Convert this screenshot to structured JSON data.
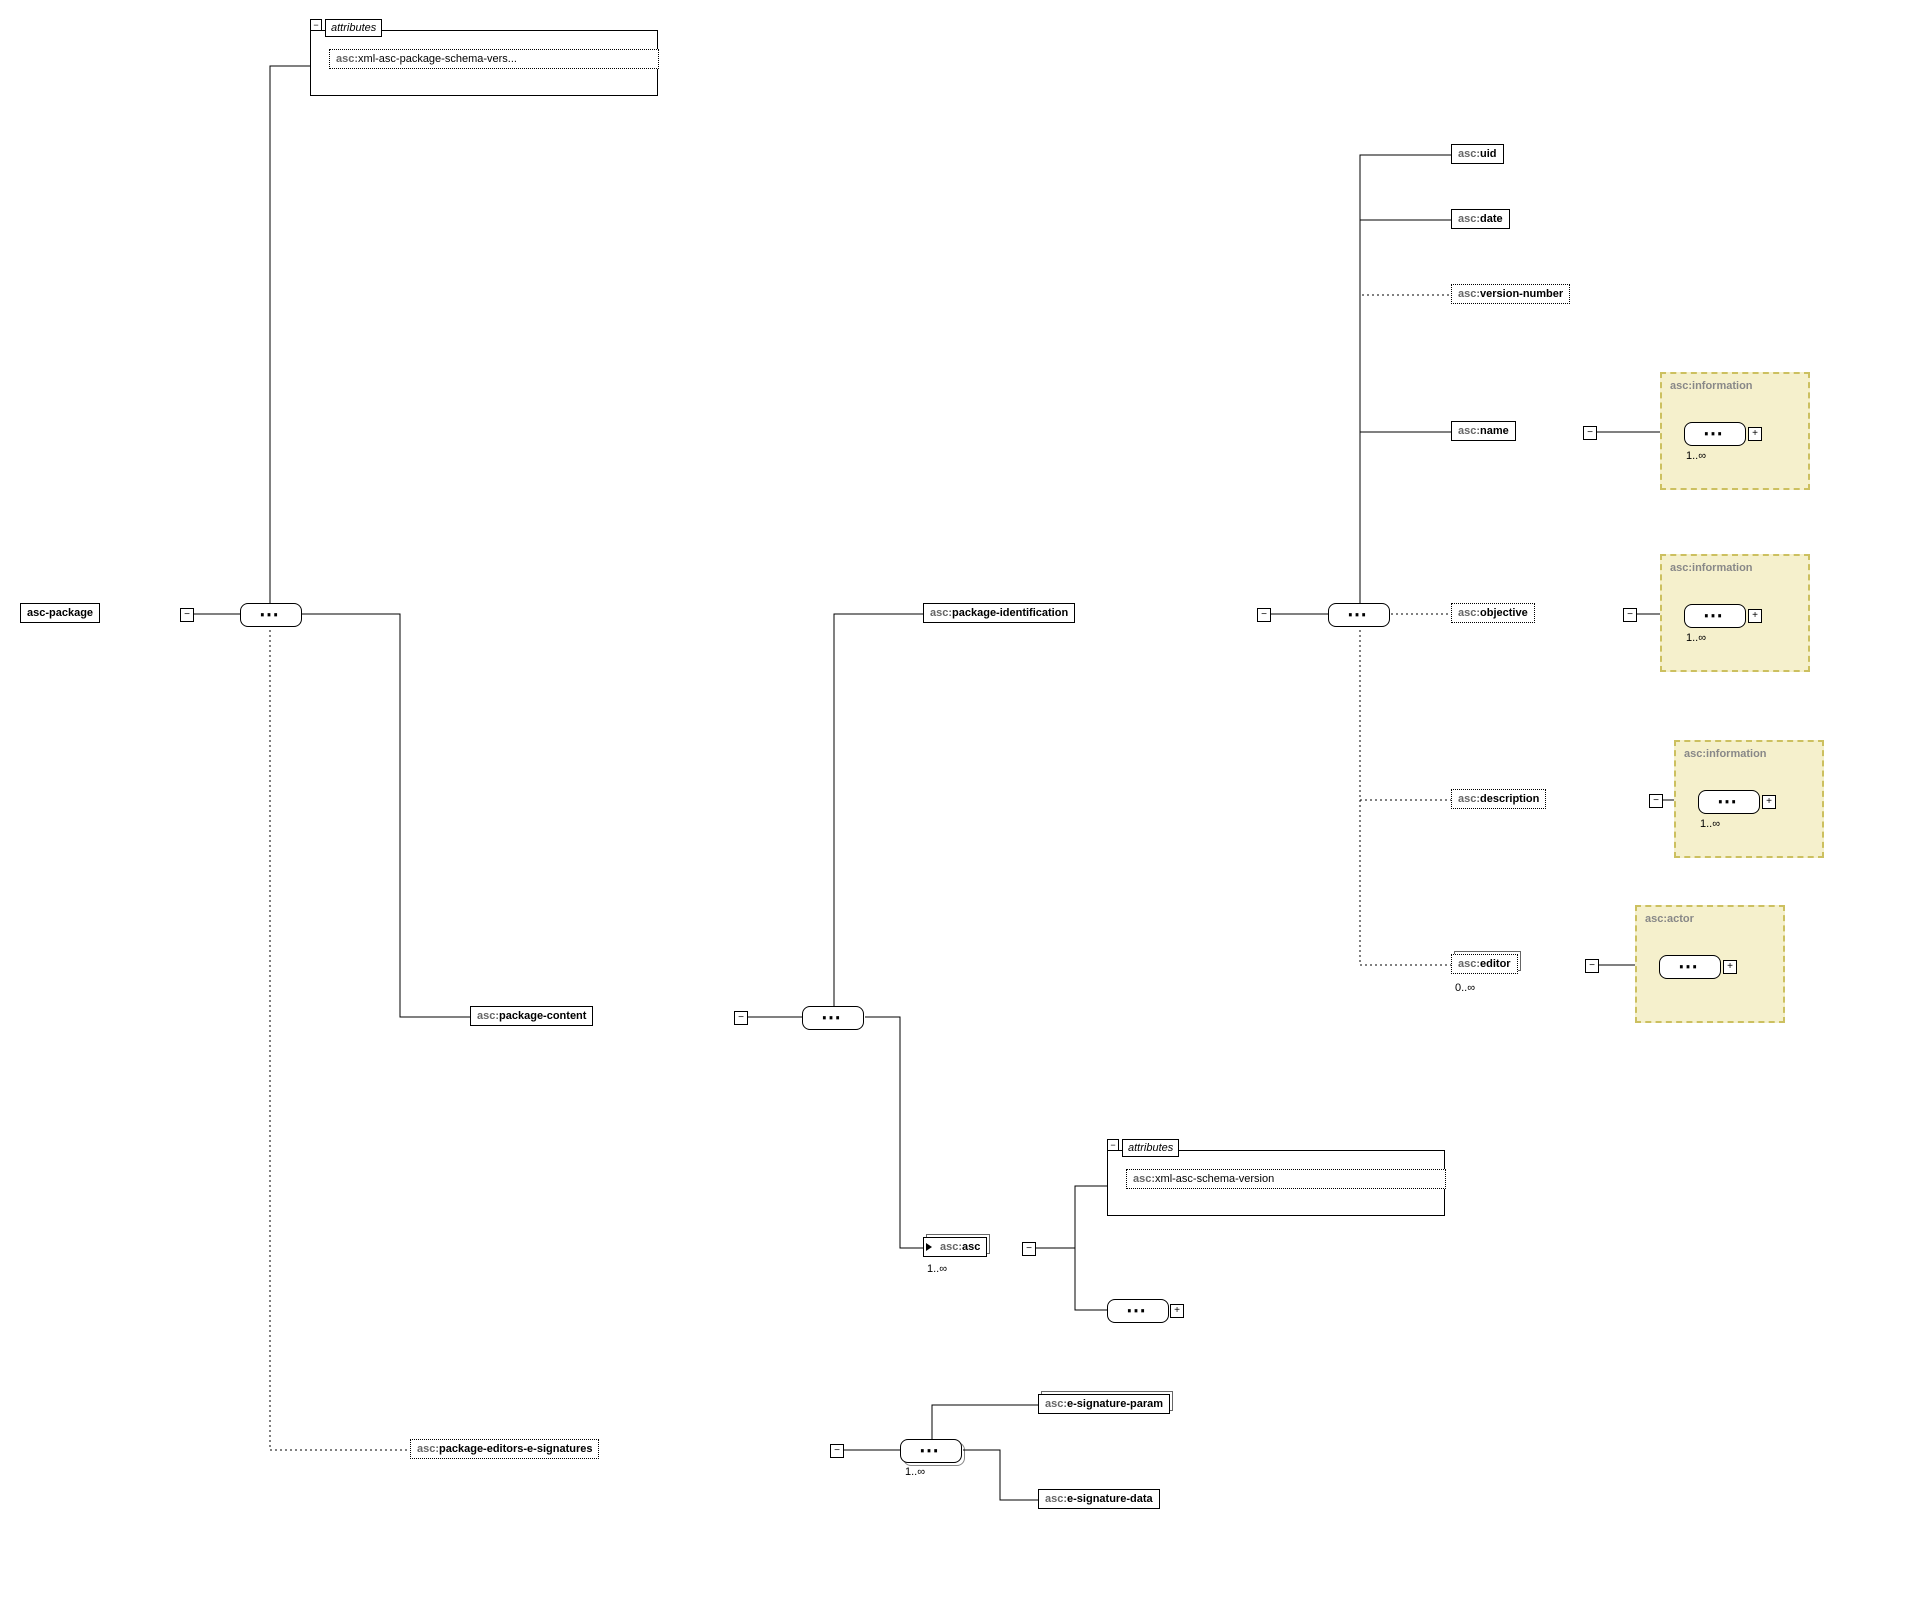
{
  "root": {
    "label": "asc-package"
  },
  "attributes1": {
    "label": "attributes",
    "item": "xml-asc-package-schema-vers..."
  },
  "packageContent": {
    "label": "package-content"
  },
  "packageEditorsESignatures": {
    "label": "package-editors-e-signatures"
  },
  "packageIdentification": {
    "label": "package-identification"
  },
  "ascAsc": {
    "label": "asc",
    "cardinality": "1..∞"
  },
  "attributes2": {
    "label": "attributes",
    "item": "xml-asc-schema-version"
  },
  "eSigParam": {
    "label": "e-signature-param"
  },
  "eSigData": {
    "label": "e-signature-data"
  },
  "eSigCardinality": "1..∞",
  "uid": {
    "label": "uid"
  },
  "date": {
    "label": "date"
  },
  "versionNumber": {
    "label": "version-number"
  },
  "name": {
    "label": "name",
    "type": "asc:information",
    "cardinality": "1..∞"
  },
  "objective": {
    "label": "objective",
    "type": "asc:information",
    "cardinality": "1..∞"
  },
  "description": {
    "label": "description",
    "type": "asc:information",
    "cardinality": "1..∞"
  },
  "editor": {
    "label": "editor",
    "type": "asc:actor",
    "cardinality": "0..∞"
  },
  "prefix": "asc:"
}
